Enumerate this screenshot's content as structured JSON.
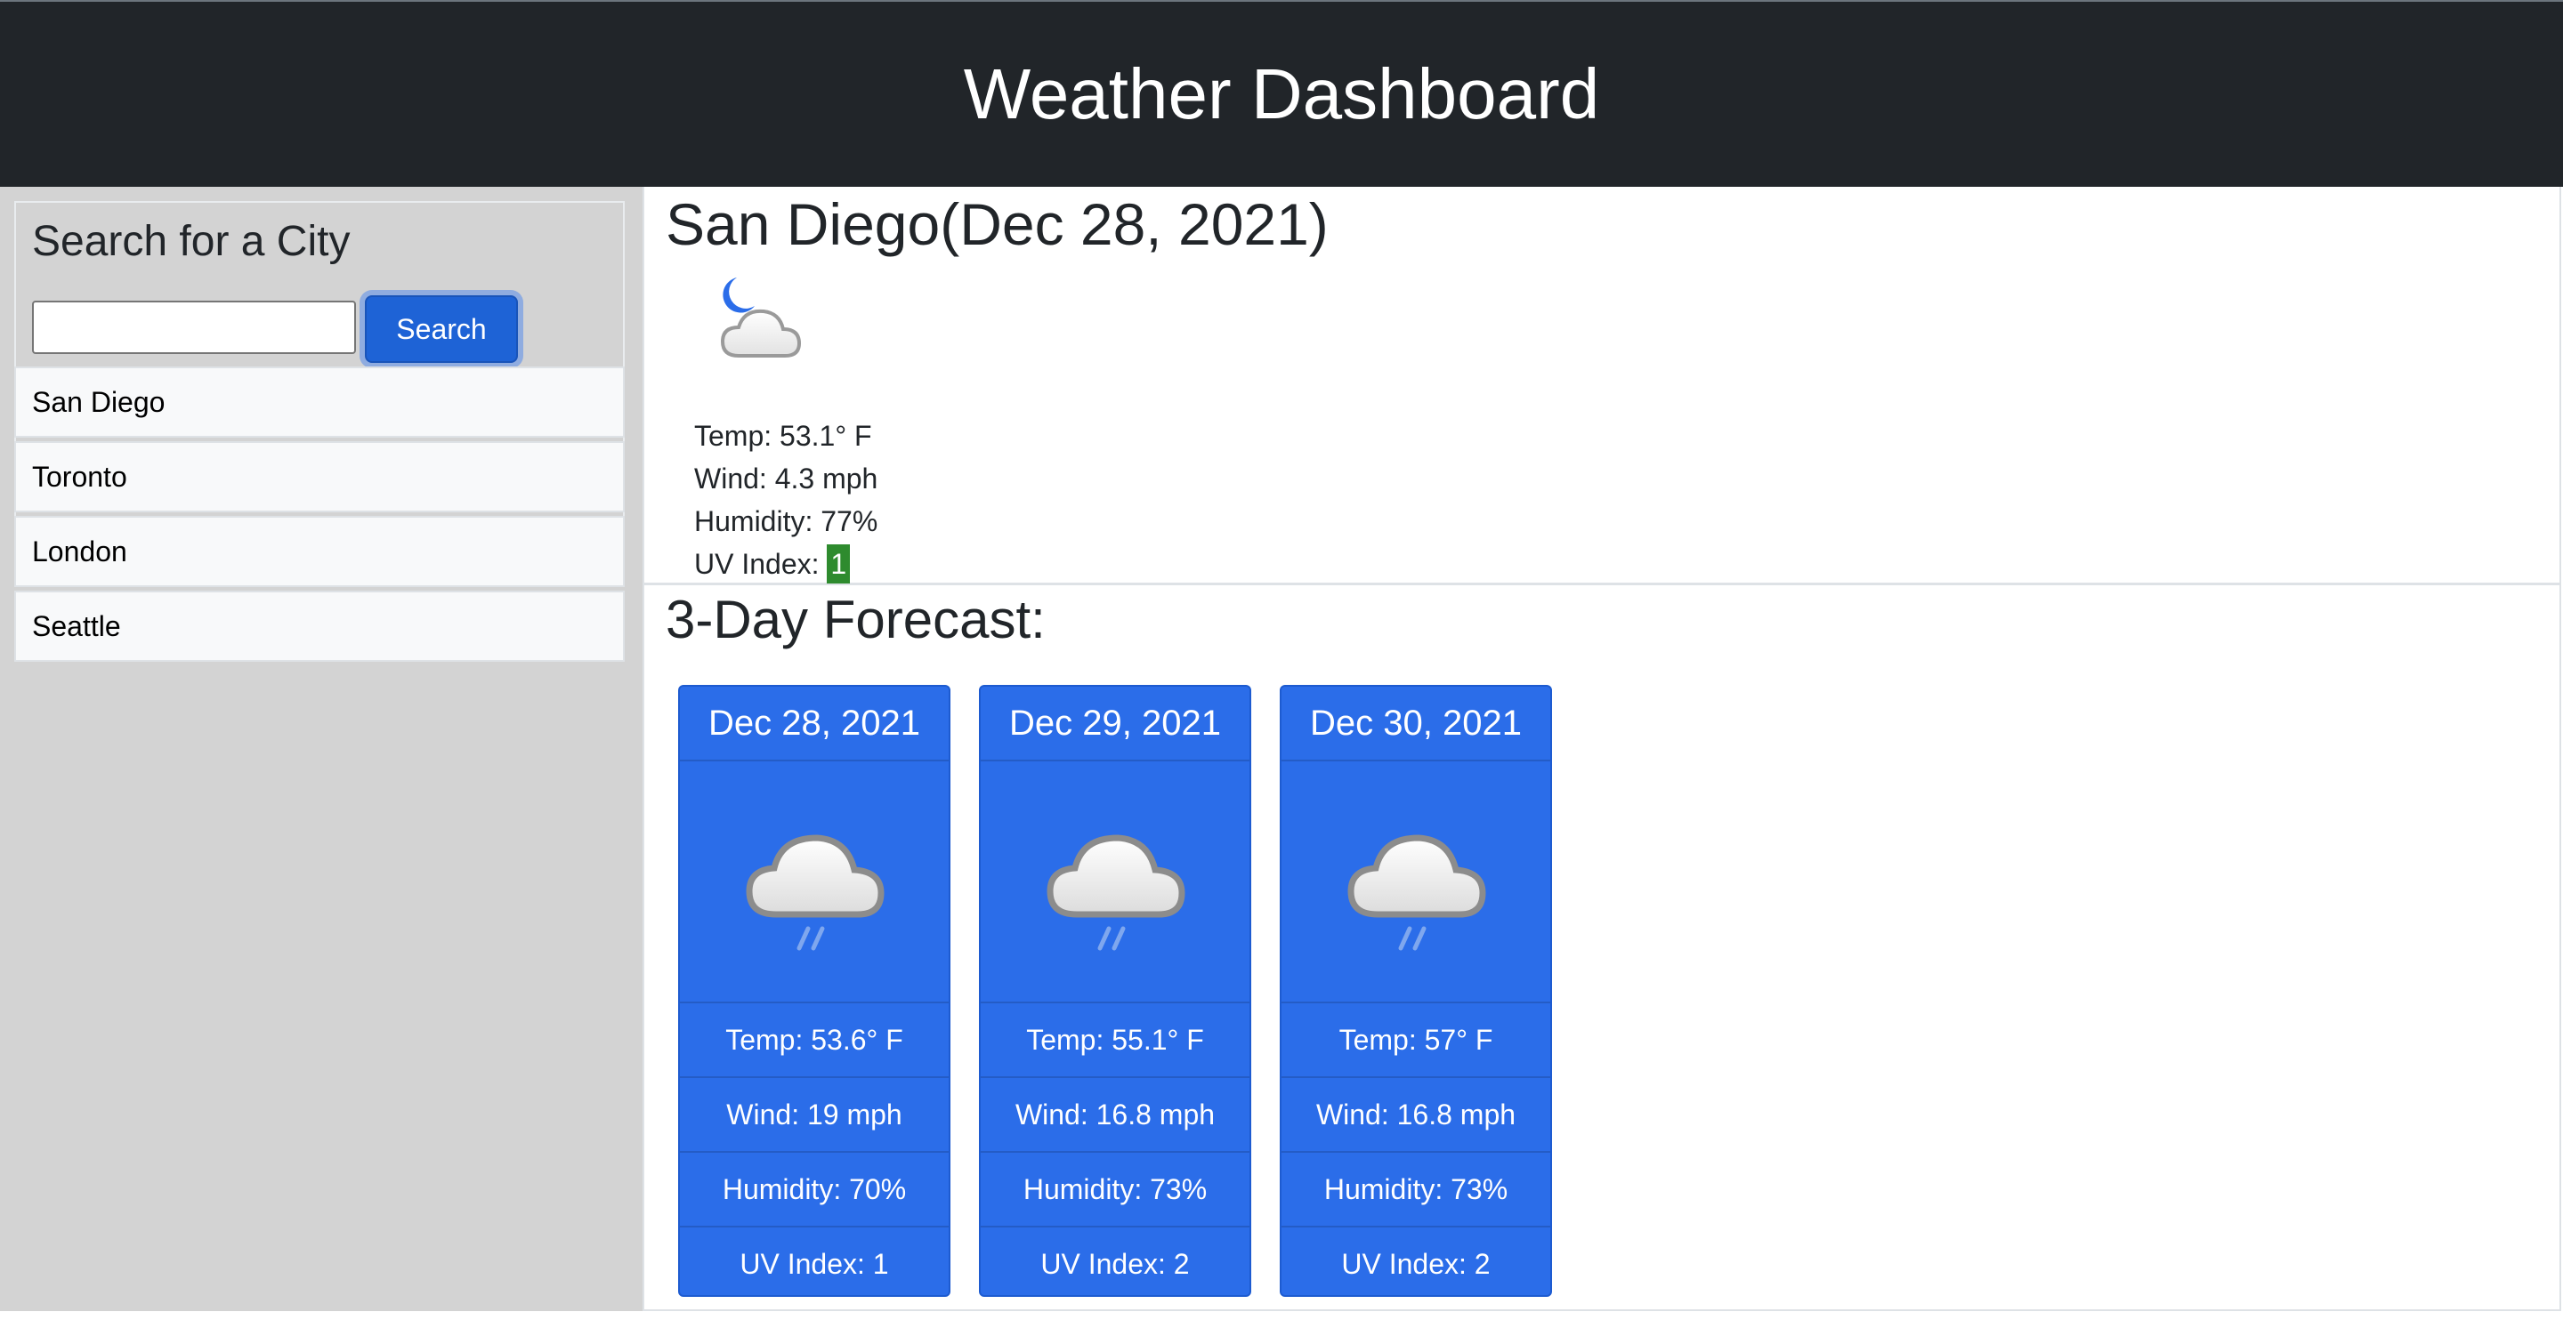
{
  "header": {
    "title": "Weather Dashboard"
  },
  "sidebar": {
    "title": "Search for a City",
    "search_value": "",
    "search_button": "Search",
    "history": [
      "San Diego",
      "Toronto",
      "London",
      "Seattle"
    ]
  },
  "current": {
    "city_heading": "San Diego(Dec 28, 2021)",
    "icon": "moon-cloud-icon",
    "temp": "Temp: 53.1° F",
    "wind": "Wind: 4.3 mph",
    "humidity": "Humidity: 77%",
    "uv_label": "UV Index: ",
    "uv_value": "1",
    "uv_color": "#2e8b2e"
  },
  "forecast": {
    "title": "3-Day Forecast:",
    "days": [
      {
        "date": "Dec 28, 2021",
        "icon": "rain-cloud-icon",
        "temp": "Temp: 53.6° F",
        "wind": "Wind: 19 mph",
        "humidity": "Humidity: 70%",
        "uv": "UV Index: 1"
      },
      {
        "date": "Dec 29, 2021",
        "icon": "rain-cloud-icon",
        "temp": "Temp: 55.1° F",
        "wind": "Wind: 16.8 mph",
        "humidity": "Humidity: 73%",
        "uv": "UV Index: 2"
      },
      {
        "date": "Dec 30, 2021",
        "icon": "rain-cloud-icon",
        "temp": "Temp: 57° F",
        "wind": "Wind: 16.8 mph",
        "humidity": "Humidity: 73%",
        "uv": "UV Index: 2"
      }
    ]
  },
  "colors": {
    "header_bg": "#212529",
    "sidebar_bg": "#d3d3d3",
    "card_bg": "#2b6de9",
    "button_bg": "#1e63d6"
  }
}
